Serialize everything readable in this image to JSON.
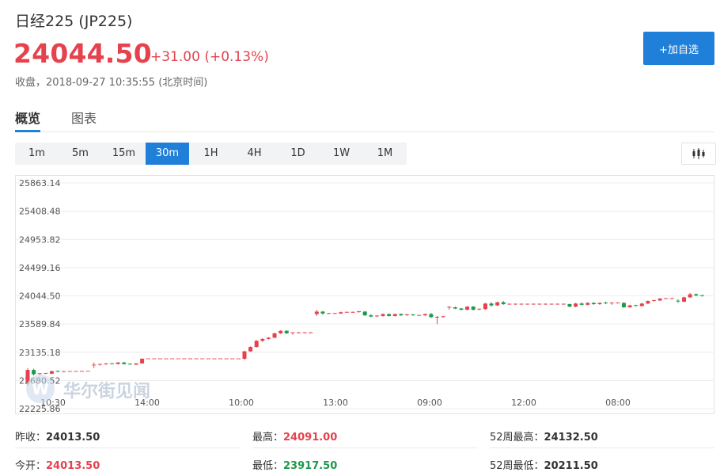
{
  "header": {
    "title": "日经225  (JP225)",
    "price": "24044.50",
    "change": "+31.00 (+0.13%)",
    "status": "收盘，2018-09-27 10:35:55 (北京时间)",
    "add_button": "+加自选"
  },
  "tabs": [
    {
      "label": "概览",
      "active": true
    },
    {
      "label": "图表",
      "active": false
    }
  ],
  "periods": [
    {
      "label": "1m",
      "active": false
    },
    {
      "label": "5m",
      "active": false
    },
    {
      "label": "15m",
      "active": false
    },
    {
      "label": "30m",
      "active": true
    },
    {
      "label": "1H",
      "active": false
    },
    {
      "label": "4H",
      "active": false
    },
    {
      "label": "1D",
      "active": false
    },
    {
      "label": "1W",
      "active": false
    },
    {
      "label": "1M",
      "active": false
    }
  ],
  "chart_type_icon": "candlestick-icon",
  "watermark": "华尔街见闻",
  "chart_data": {
    "type": "candlestick",
    "y_ticks": [
      "25863.14",
      "25408.48",
      "24953.82",
      "24499.16",
      "24044.50",
      "23589.84",
      "23135.18",
      "22680.52",
      "22225.86"
    ],
    "ylim": [
      22225.86,
      25863.14
    ],
    "x_ticks": [
      "10:30",
      "14:00",
      "10:00",
      "13:00",
      "09:00",
      "12:00",
      "08:00"
    ],
    "reference_price": 24044.5,
    "colors": {
      "up": "#e5424d",
      "down": "#1a9a4a",
      "grid": "#ececec"
    },
    "candles": [
      {
        "o": 22650,
        "h": 22880,
        "l": 22600,
        "c": 22850
      },
      {
        "o": 22850,
        "h": 22870,
        "l": 22760,
        "c": 22780
      },
      {
        "o": 22780,
        "h": 22800,
        "l": 22770,
        "c": 22790
      },
      {
        "o": 22790,
        "h": 22800,
        "l": 22780,
        "c": 22795
      },
      {
        "o": 22790,
        "h": 22840,
        "l": 22780,
        "c": 22830
      },
      {
        "o": 22830,
        "h": 22840,
        "l": 22810,
        "c": 22820
      },
      {
        "o": 22820,
        "h": 22830,
        "l": 22810,
        "c": 22825
      },
      {
        "o": 22825,
        "h": 22830,
        "l": 22820,
        "c": 22825
      },
      {
        "o": 22825,
        "h": 22830,
        "l": 22820,
        "c": 22825
      },
      {
        "o": 22825,
        "h": 22830,
        "l": 22820,
        "c": 22828
      },
      {
        "o": 22828,
        "h": 22832,
        "l": 22825,
        "c": 22830
      },
      {
        "o": 22920,
        "h": 22970,
        "l": 22880,
        "c": 22930
      },
      {
        "o": 22930,
        "h": 22950,
        "l": 22920,
        "c": 22940
      },
      {
        "o": 22940,
        "h": 22960,
        "l": 22930,
        "c": 22950
      },
      {
        "o": 22950,
        "h": 22960,
        "l": 22940,
        "c": 22945
      },
      {
        "o": 22945,
        "h": 22975,
        "l": 22940,
        "c": 22970
      },
      {
        "o": 22970,
        "h": 22980,
        "l": 22940,
        "c": 22945
      },
      {
        "o": 22945,
        "h": 22955,
        "l": 22930,
        "c": 22935
      },
      {
        "o": 22935,
        "h": 22960,
        "l": 22930,
        "c": 22955
      },
      {
        "o": 22955,
        "h": 23040,
        "l": 22950,
        "c": 23030
      },
      {
        "o": 23030,
        "h": 23035,
        "l": 23025,
        "c": 23030
      },
      {
        "o": 23030,
        "h": 23035,
        "l": 23025,
        "c": 23030
      },
      {
        "o": 23030,
        "h": 23035,
        "l": 23025,
        "c": 23030
      },
      {
        "o": 23030,
        "h": 23035,
        "l": 23025,
        "c": 23030
      },
      {
        "o": 23030,
        "h": 23035,
        "l": 23025,
        "c": 23030
      },
      {
        "o": 23030,
        "h": 23035,
        "l": 23025,
        "c": 23030
      },
      {
        "o": 23030,
        "h": 23035,
        "l": 23025,
        "c": 23030
      },
      {
        "o": 23030,
        "h": 23035,
        "l": 23025,
        "c": 23030
      },
      {
        "o": 23030,
        "h": 23035,
        "l": 23025,
        "c": 23030
      },
      {
        "o": 23030,
        "h": 23035,
        "l": 23025,
        "c": 23030
      },
      {
        "o": 23030,
        "h": 23035,
        "l": 23025,
        "c": 23030
      },
      {
        "o": 23030,
        "h": 23035,
        "l": 23025,
        "c": 23030
      },
      {
        "o": 23030,
        "h": 23035,
        "l": 23025,
        "c": 23030
      },
      {
        "o": 23030,
        "h": 23035,
        "l": 23025,
        "c": 23030
      },
      {
        "o": 23030,
        "h": 23035,
        "l": 23025,
        "c": 23030
      },
      {
        "o": 23030,
        "h": 23035,
        "l": 23025,
        "c": 23030
      },
      {
        "o": 23030,
        "h": 23160,
        "l": 23010,
        "c": 23150
      },
      {
        "o": 23150,
        "h": 23230,
        "l": 23140,
        "c": 23220
      },
      {
        "o": 23220,
        "h": 23330,
        "l": 23210,
        "c": 23320
      },
      {
        "o": 23320,
        "h": 23360,
        "l": 23300,
        "c": 23350
      },
      {
        "o": 23350,
        "h": 23380,
        "l": 23340,
        "c": 23370
      },
      {
        "o": 23370,
        "h": 23450,
        "l": 23360,
        "c": 23440
      },
      {
        "o": 23440,
        "h": 23490,
        "l": 23430,
        "c": 23480
      },
      {
        "o": 23480,
        "h": 23490,
        "l": 23430,
        "c": 23440
      },
      {
        "o": 23440,
        "h": 23460,
        "l": 23420,
        "c": 23450
      },
      {
        "o": 23450,
        "h": 23460,
        "l": 23440,
        "c": 23450
      },
      {
        "o": 23450,
        "h": 23460,
        "l": 23440,
        "c": 23450
      },
      {
        "o": 23450,
        "h": 23460,
        "l": 23440,
        "c": 23450
      },
      {
        "o": 23750,
        "h": 23820,
        "l": 23720,
        "c": 23790
      },
      {
        "o": 23790,
        "h": 23800,
        "l": 23740,
        "c": 23760
      },
      {
        "o": 23760,
        "h": 23770,
        "l": 23750,
        "c": 23760
      },
      {
        "o": 23760,
        "h": 23770,
        "l": 23750,
        "c": 23760
      },
      {
        "o": 23760,
        "h": 23790,
        "l": 23750,
        "c": 23780
      },
      {
        "o": 23780,
        "h": 23790,
        "l": 23770,
        "c": 23780
      },
      {
        "o": 23780,
        "h": 23790,
        "l": 23770,
        "c": 23780
      },
      {
        "o": 23780,
        "h": 23800,
        "l": 23770,
        "c": 23790
      },
      {
        "o": 23790,
        "h": 23800,
        "l": 23720,
        "c": 23730
      },
      {
        "o": 23730,
        "h": 23750,
        "l": 23700,
        "c": 23710
      },
      {
        "o": 23710,
        "h": 23730,
        "l": 23700,
        "c": 23720
      },
      {
        "o": 23720,
        "h": 23760,
        "l": 23710,
        "c": 23750
      },
      {
        "o": 23750,
        "h": 23760,
        "l": 23710,
        "c": 23720
      },
      {
        "o": 23720,
        "h": 23760,
        "l": 23710,
        "c": 23750
      },
      {
        "o": 23750,
        "h": 23760,
        "l": 23720,
        "c": 23730
      },
      {
        "o": 23730,
        "h": 23750,
        "l": 23720,
        "c": 23740
      },
      {
        "o": 23740,
        "h": 23750,
        "l": 23720,
        "c": 23730
      },
      {
        "o": 23730,
        "h": 23740,
        "l": 23720,
        "c": 23730
      },
      {
        "o": 23730,
        "h": 23760,
        "l": 23720,
        "c": 23750
      },
      {
        "o": 23750,
        "h": 23770,
        "l": 23690,
        "c": 23700
      },
      {
        "o": 23700,
        "h": 23720,
        "l": 23590,
        "c": 23700
      },
      {
        "o": 23700,
        "h": 23720,
        "l": 23690,
        "c": 23710
      },
      {
        "o": 23850,
        "h": 23880,
        "l": 23820,
        "c": 23860
      },
      {
        "o": 23860,
        "h": 23870,
        "l": 23830,
        "c": 23840
      },
      {
        "o": 23840,
        "h": 23850,
        "l": 23810,
        "c": 23820
      },
      {
        "o": 23820,
        "h": 23880,
        "l": 23810,
        "c": 23870
      },
      {
        "o": 23870,
        "h": 23880,
        "l": 23810,
        "c": 23820
      },
      {
        "o": 23820,
        "h": 23840,
        "l": 23810,
        "c": 23830
      },
      {
        "o": 23830,
        "h": 23930,
        "l": 23820,
        "c": 23920
      },
      {
        "o": 23920,
        "h": 23940,
        "l": 23870,
        "c": 23890
      },
      {
        "o": 23890,
        "h": 23950,
        "l": 23880,
        "c": 23940
      },
      {
        "o": 23940,
        "h": 23960,
        "l": 23900,
        "c": 23910
      },
      {
        "o": 23910,
        "h": 23920,
        "l": 23900,
        "c": 23910
      },
      {
        "o": 23910,
        "h": 23920,
        "l": 23900,
        "c": 23910
      },
      {
        "o": 23910,
        "h": 23920,
        "l": 23900,
        "c": 23910
      },
      {
        "o": 23910,
        "h": 23920,
        "l": 23900,
        "c": 23910
      },
      {
        "o": 23910,
        "h": 23920,
        "l": 23900,
        "c": 23910
      },
      {
        "o": 23910,
        "h": 23920,
        "l": 23900,
        "c": 23910
      },
      {
        "o": 23910,
        "h": 23920,
        "l": 23900,
        "c": 23910
      },
      {
        "o": 23910,
        "h": 23920,
        "l": 23900,
        "c": 23910
      },
      {
        "o": 23910,
        "h": 23920,
        "l": 23900,
        "c": 23910
      },
      {
        "o": 23910,
        "h": 23920,
        "l": 23900,
        "c": 23910
      },
      {
        "o": 23910,
        "h": 23920,
        "l": 23860,
        "c": 23870
      },
      {
        "o": 23870,
        "h": 23930,
        "l": 23860,
        "c": 23920
      },
      {
        "o": 23920,
        "h": 23940,
        "l": 23890,
        "c": 23900
      },
      {
        "o": 23900,
        "h": 23940,
        "l": 23890,
        "c": 23930
      },
      {
        "o": 23930,
        "h": 23940,
        "l": 23900,
        "c": 23910
      },
      {
        "o": 23910,
        "h": 23940,
        "l": 23900,
        "c": 23930
      },
      {
        "o": 23930,
        "h": 23950,
        "l": 23910,
        "c": 23920
      },
      {
        "o": 23920,
        "h": 23940,
        "l": 23900,
        "c": 23930
      },
      {
        "o": 23930,
        "h": 23940,
        "l": 23920,
        "c": 23930
      },
      {
        "o": 23930,
        "h": 23940,
        "l": 23850,
        "c": 23860
      },
      {
        "o": 23860,
        "h": 23900,
        "l": 23850,
        "c": 23890
      },
      {
        "o": 23890,
        "h": 23900,
        "l": 23870,
        "c": 23880
      },
      {
        "o": 23880,
        "h": 23930,
        "l": 23870,
        "c": 23920
      },
      {
        "o": 23920,
        "h": 23970,
        "l": 23910,
        "c": 23960
      },
      {
        "o": 23960,
        "h": 23980,
        "l": 23950,
        "c": 23970
      },
      {
        "o": 23970,
        "h": 24010,
        "l": 23960,
        "c": 24000
      },
      {
        "o": 24000,
        "h": 24010,
        "l": 23990,
        "c": 24000
      },
      {
        "o": 24000,
        "h": 24010,
        "l": 23990,
        "c": 24000
      },
      {
        "o": 23960,
        "h": 23990,
        "l": 23930,
        "c": 23950
      },
      {
        "o": 23950,
        "h": 24030,
        "l": 23940,
        "c": 24020
      },
      {
        "o": 24020,
        "h": 24091,
        "l": 24010,
        "c": 24070
      },
      {
        "o": 24070,
        "h": 24080,
        "l": 24040,
        "c": 24050
      },
      {
        "o": 24050,
        "h": 24060,
        "l": 24030,
        "c": 24044.5
      }
    ]
  },
  "stats": [
    {
      "label": "昨收：",
      "value": "24013.50",
      "color": "dark"
    },
    {
      "label": "最高：",
      "value": "24091.00",
      "color": "red"
    },
    {
      "label": "52周最高：",
      "value": "24132.50",
      "color": "dark"
    },
    {
      "label": "今开：",
      "value": "24013.50",
      "color": "red"
    },
    {
      "label": "最低：",
      "value": "23917.50",
      "color": "green"
    },
    {
      "label": "52周最低：",
      "value": "20211.50",
      "color": "dark"
    }
  ]
}
